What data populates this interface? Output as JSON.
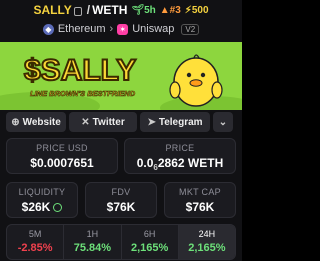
{
  "header": {
    "symbol": "SALLY",
    "separator": "/",
    "quote": "WETH",
    "badges": [
      {
        "icon": "sprout-icon",
        "text": "5h",
        "color": "#6de07a"
      },
      {
        "icon": "fire-icon",
        "text": "#3",
        "color": "#ff9b3d"
      },
      {
        "icon": "lightning-icon",
        "text": "500",
        "color": "#f4d23f"
      }
    ]
  },
  "chain": {
    "network": "Ethereum",
    "dex": "Uniswap",
    "version": "V2"
  },
  "banner": {
    "title": "$SALLY",
    "subtitle": "LINE BROWN'S BESTFRIEND"
  },
  "links": {
    "website": "Website",
    "twitter": "Twitter",
    "telegram": "Telegram"
  },
  "prices": {
    "usd_label": "PRICE USD",
    "usd_value": "$0.0007651",
    "native_label": "PRICE",
    "native_prefix": "0.0",
    "native_zeros": "6",
    "native_digits": "2862",
    "native_unit": "WETH"
  },
  "stats": {
    "liquidity_label": "LIQUIDITY",
    "liquidity_value": "$26K",
    "fdv_label": "FDV",
    "fdv_value": "$76K",
    "mktcap_label": "MKT CAP",
    "mktcap_value": "$76K"
  },
  "changes": [
    {
      "label": "5M",
      "value": "-2.85%",
      "dir": "neg"
    },
    {
      "label": "1H",
      "value": "75.84%",
      "dir": "pos"
    },
    {
      "label": "6H",
      "value": "2,165%",
      "dir": "pos"
    },
    {
      "label": "24H",
      "value": "2,165%",
      "dir": "pos",
      "active": true
    }
  ],
  "colors": {
    "accent_yellow": "#f4d23f",
    "positive": "#6de07a",
    "negative": "#f0414e",
    "banner_green": "#8dd63e"
  }
}
